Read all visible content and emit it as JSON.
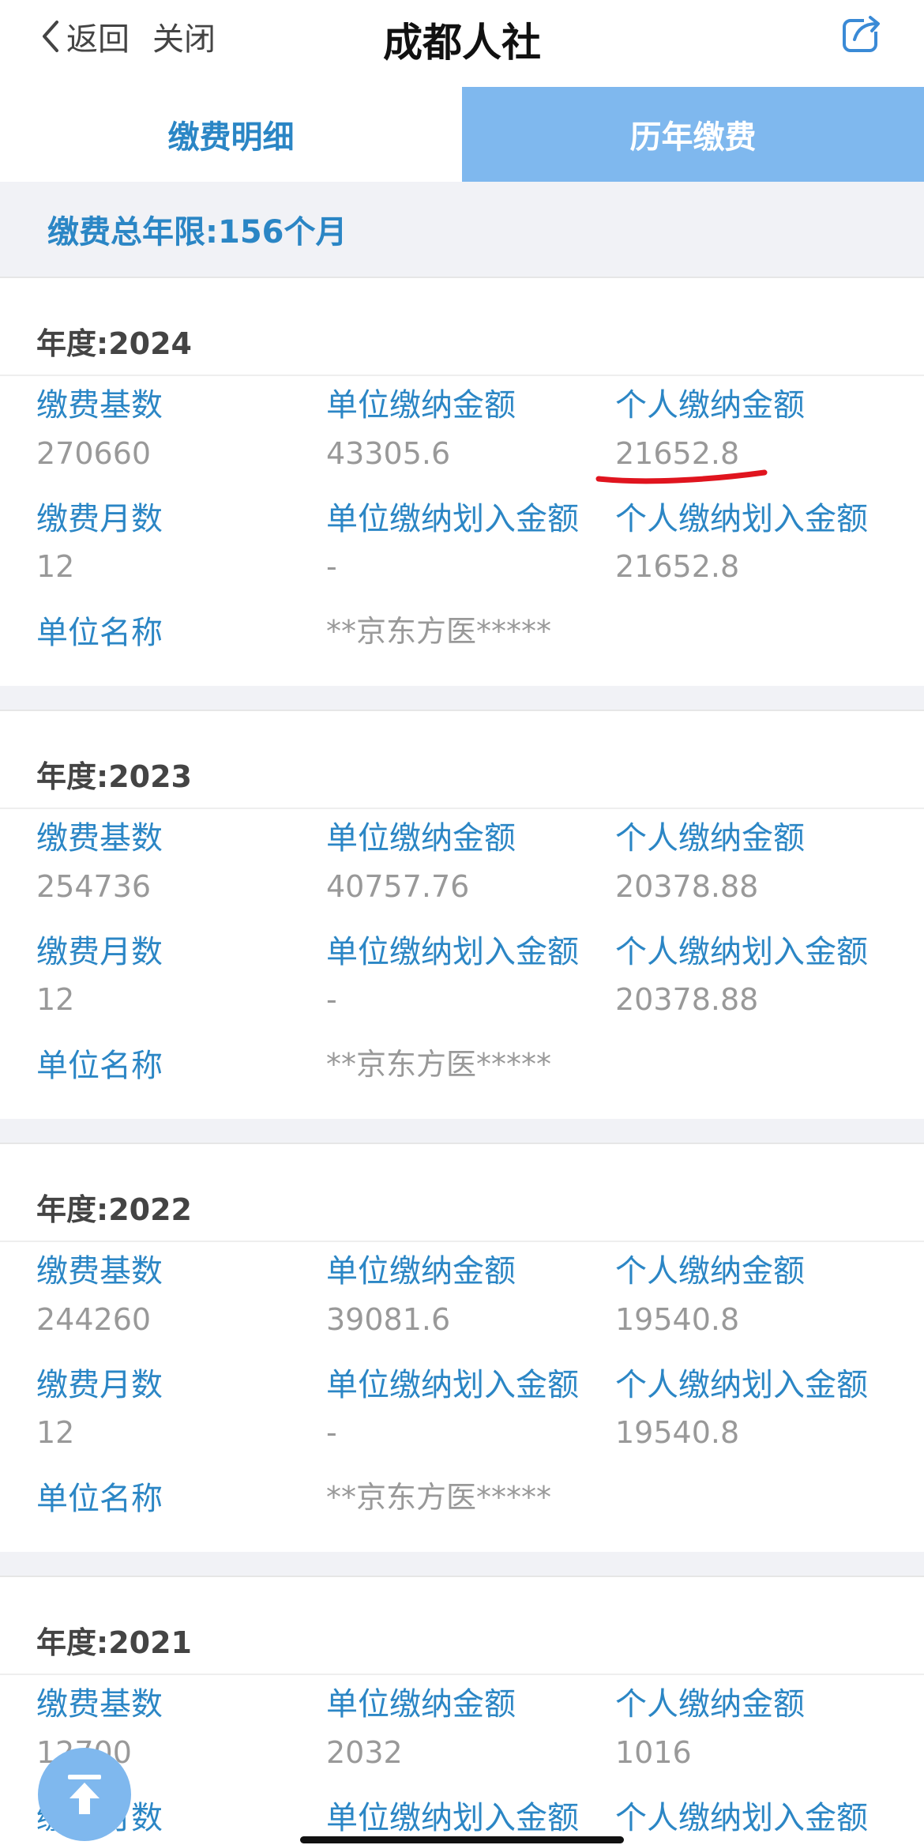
{
  "nav": {
    "back_label": "返回",
    "close_label": "关闭",
    "title": "成都人社"
  },
  "tabs": [
    {
      "label": "缴费明细"
    },
    {
      "label": "历年缴费"
    }
  ],
  "summary": {
    "text": "缴费总年限:156个月"
  },
  "labels": {
    "base": "缴费基数",
    "unit_amount": "单位缴纳金额",
    "personal_amount": "个人缴纳金额",
    "months": "缴费月数",
    "unit_transfer": "单位缴纳划入金额",
    "personal_transfer": "个人缴纳划入金额",
    "employer": "单位名称"
  },
  "years": [
    {
      "title": "年度:2024",
      "base": "270660",
      "unit_amount": "43305.6",
      "personal_amount": "21652.8",
      "months": "12",
      "unit_transfer": "-",
      "personal_transfer": "21652.8",
      "employer": "**京东方医*****"
    },
    {
      "title": "年度:2023",
      "base": "254736",
      "unit_amount": "40757.76",
      "personal_amount": "20378.88",
      "months": "12",
      "unit_transfer": "-",
      "personal_transfer": "20378.88",
      "employer": "**京东方医*****"
    },
    {
      "title": "年度:2022",
      "base": "244260",
      "unit_amount": "39081.6",
      "personal_amount": "19540.8",
      "months": "12",
      "unit_transfer": "-",
      "personal_transfer": "19540.8",
      "employer": "**京东方医*****"
    },
    {
      "title": "年度:2021",
      "base": "12700",
      "unit_amount": "2032",
      "personal_amount": "1016"
    }
  ],
  "colors": {
    "accent": "#2b86c5",
    "tab_active_bg": "#7fb8ee",
    "value": "#999999",
    "annotation": "#e0141e"
  },
  "icons": {
    "back": "chevron-left-icon",
    "share": "share-icon",
    "fab": "back-to-top-icon"
  }
}
